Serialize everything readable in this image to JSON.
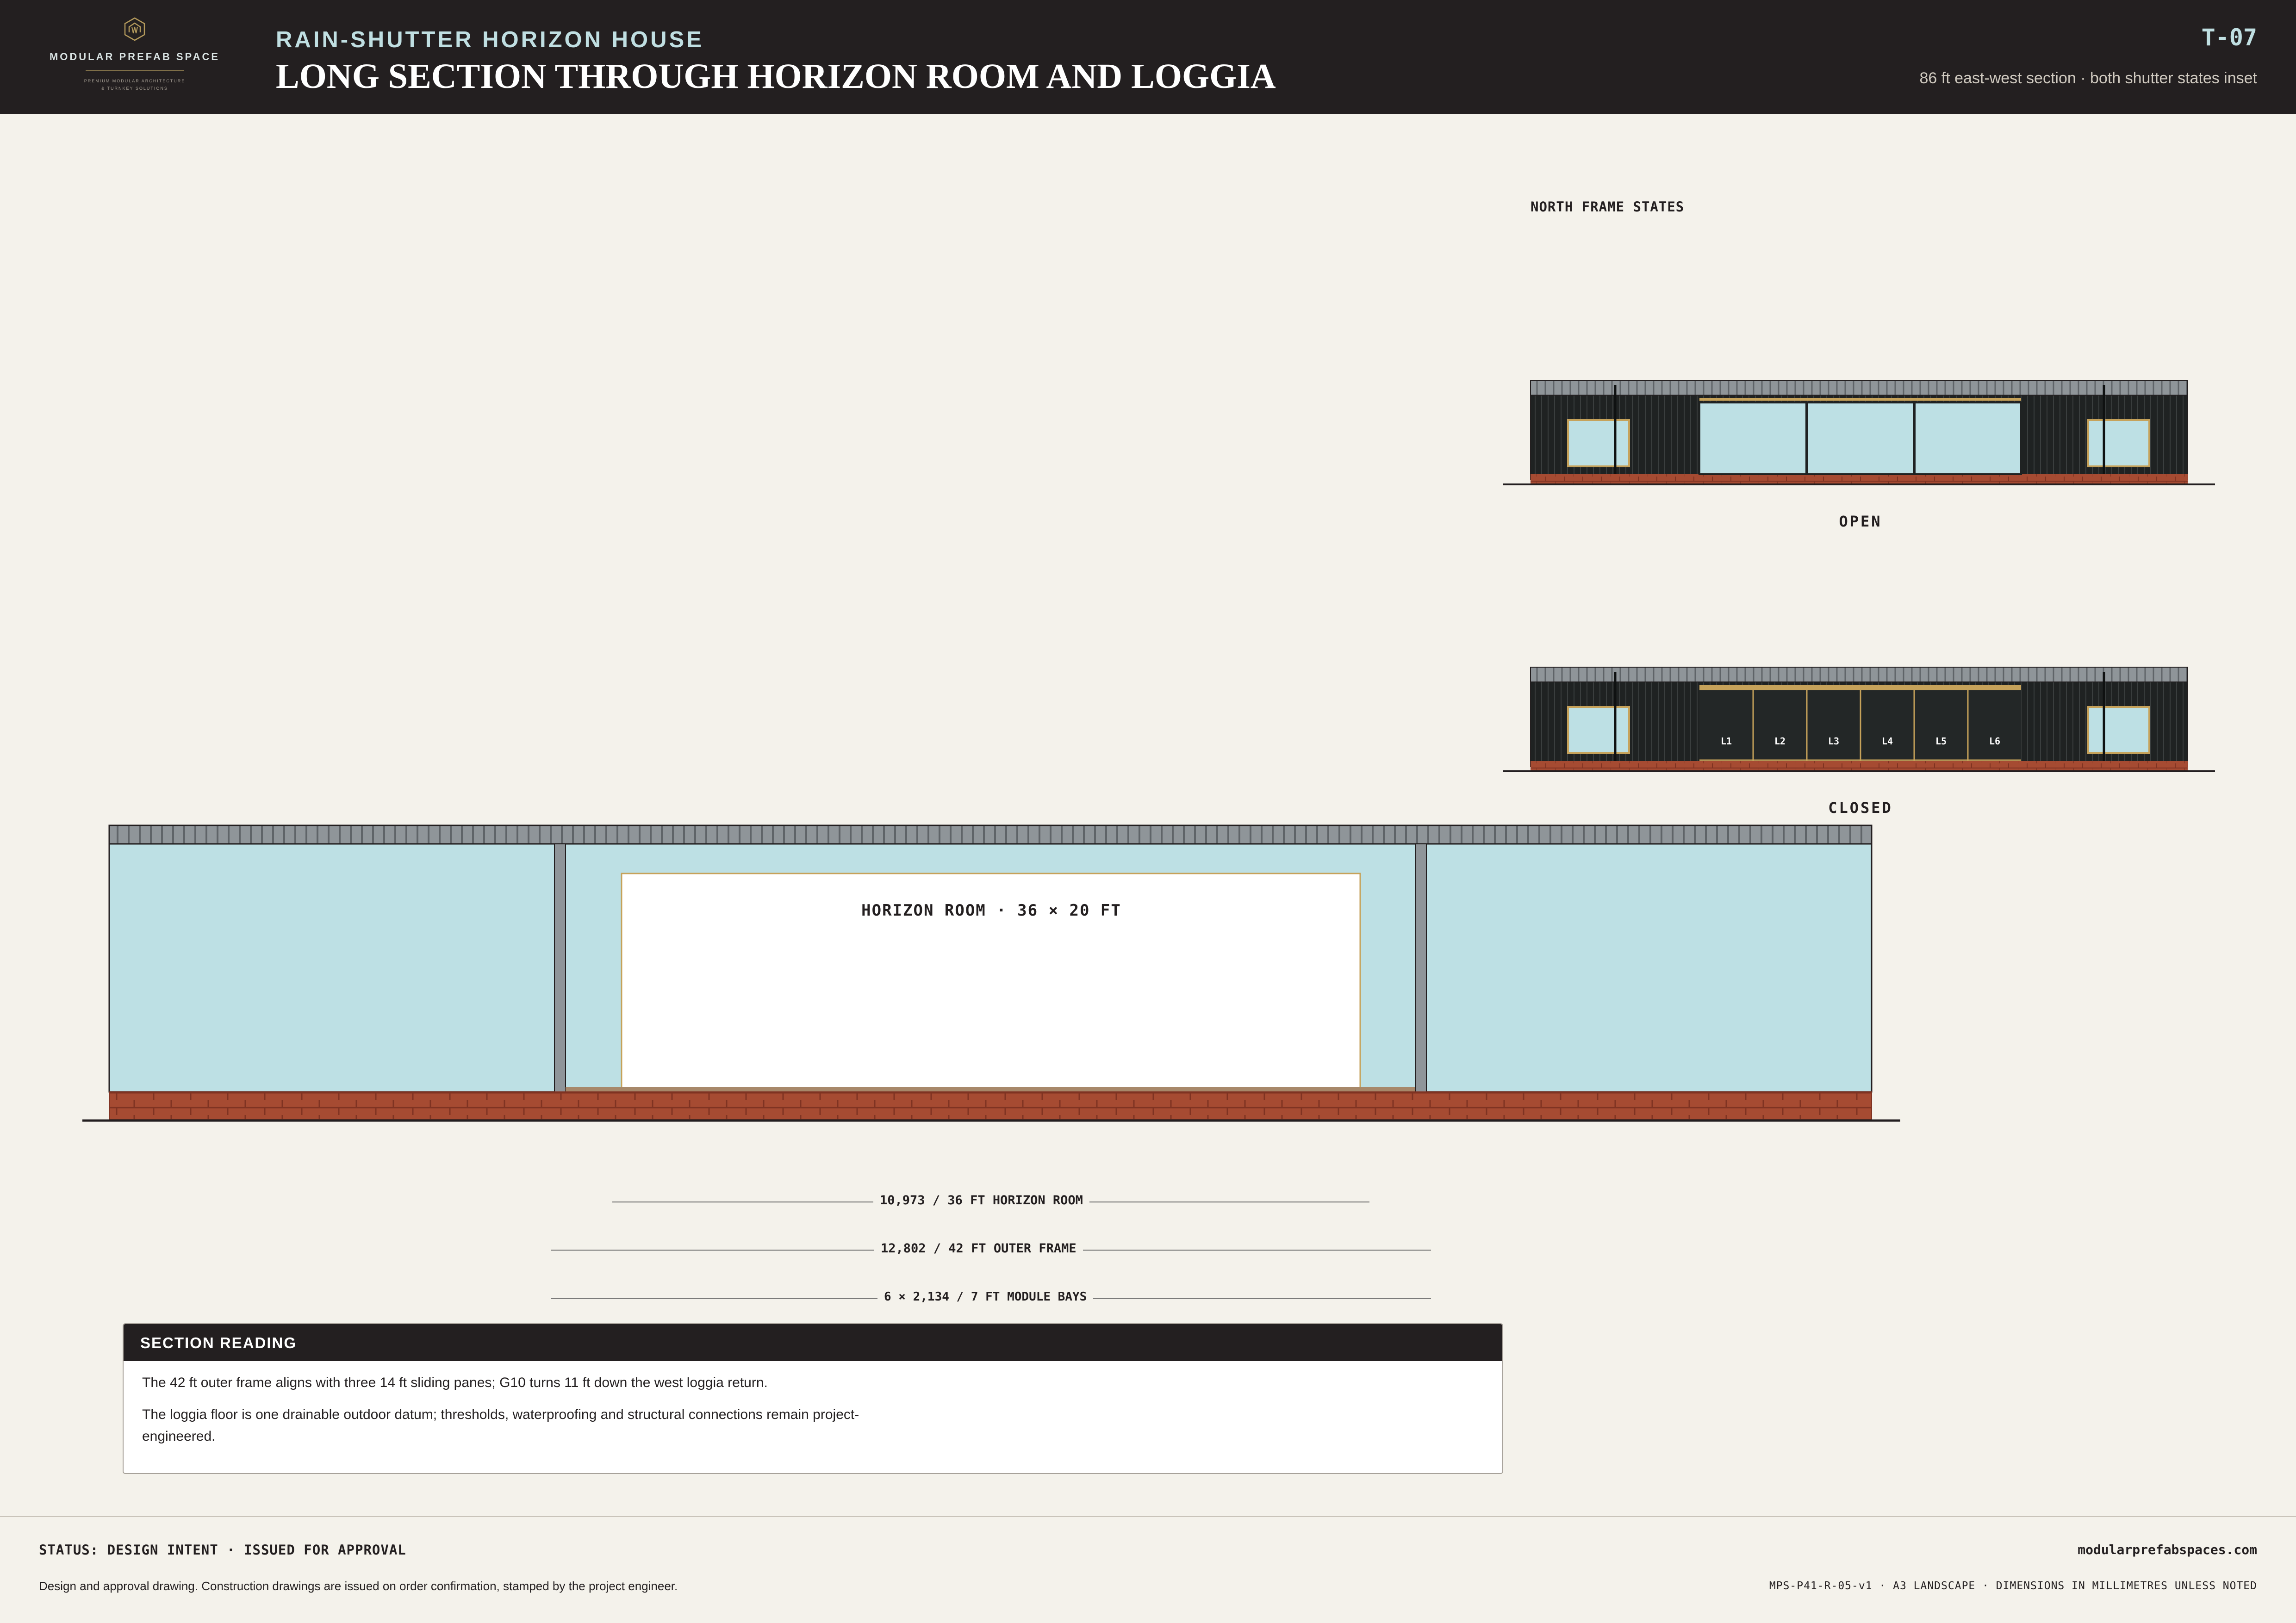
{
  "brand": {
    "name": "MODULAR PREFAB SPACE",
    "tagline_line1": "PREMIUM MODULAR ARCHITECTURE",
    "tagline_line2": "& TURNKEY SOLUTIONS",
    "logo_icon": "hexagon-house-icon"
  },
  "header": {
    "project": "RAIN-SHUTTER HORIZON HOUSE",
    "title": "LONG SECTION THROUGH HORIZON ROOM AND LOGGIA",
    "sheet_number": "T-07",
    "subtitle": "86 ft east-west section · both shutter states inset"
  },
  "insets": {
    "heading": "NORTH FRAME STATES",
    "open_label": "OPEN",
    "closed_label": "CLOSED",
    "louvre_labels": [
      "L1",
      "L2",
      "L3",
      "L4",
      "L5",
      "L6"
    ]
  },
  "section": {
    "room_label": "HORIZON ROOM · 36 × 20 FT"
  },
  "dimensions": {
    "horizon_room": "10,973 / 36 FT HORIZON ROOM",
    "outer_frame": "12,802 / 42 FT OUTER FRAME",
    "module_bays": "6 × 2,134 / 7 FT MODULE BAYS"
  },
  "reading": {
    "title": "SECTION READING",
    "line1": "The 42 ft outer frame aligns with three 14 ft sliding panes; G10 turns 11 ft down the west loggia return.",
    "line2": "The loggia floor is one drainable outdoor datum; thresholds, waterproofing and structural connections remain project-engineered."
  },
  "footer": {
    "status": "STATUS: DESIGN INTENT · ISSUED FOR APPROVAL",
    "website": "modularprefabspaces.com",
    "note": "Design and approval drawing. Construction drawings are issued on order confirmation, stamped by the project engineer.",
    "doc_code": "MPS-P41-R-05-v1 · A3 LANDSCAPE · DIMENSIONS IN MILLIMETRES UNLESS NOTED"
  },
  "colors": {
    "header_bg": "#231f20",
    "page_bg": "#f4f2eb",
    "glass": "#bde0e4",
    "cladding": "#1f2222",
    "roof": "#8f9599",
    "brick": "#a64b32",
    "timber": "#c6a25a"
  }
}
